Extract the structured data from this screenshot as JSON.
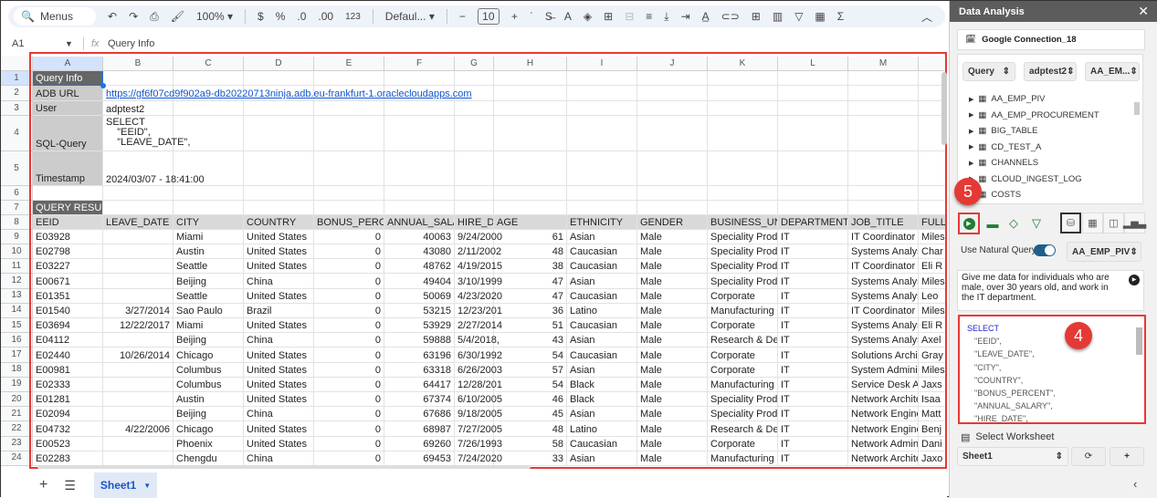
{
  "toolbar": {
    "menus_label": "Menus",
    "zoom": "100%",
    "currency": "$",
    "percent": "%",
    "dec_decrease": ".0",
    "dec_increase": ".00",
    "format_123": "123",
    "font": "Defaul...",
    "font_size": "10"
  },
  "formula_bar": {
    "cell_ref": "A1",
    "fx": "fx",
    "content": "Query Info"
  },
  "columns": [
    "A",
    "B",
    "C",
    "D",
    "E",
    "F",
    "G",
    "H",
    "I",
    "J",
    "K",
    "L",
    "M",
    ""
  ],
  "info": {
    "title": "Query Info",
    "url_label": "ADB URL",
    "url": "https://gf6f07cd9f902a9-db20220713ninja.adb.eu-frankfurt-1.oraclecloudapps.com",
    "user_label": "User",
    "user": "adptest2",
    "sql_label": "SQL-Query",
    "sql": "SELECT\n    \"EEID\",\n    \"LEAVE_DATE\",",
    "ts_label": "Timestamp",
    "ts": "2024/03/07 - 18:41:00",
    "results_label": "QUERY RESULT"
  },
  "headers": [
    "EEID",
    "LEAVE_DATE",
    "CITY",
    "COUNTRY",
    "BONUS_PERCE",
    "ANNUAL_SALAI",
    "HIRE_DA",
    "AGE",
    "ETHNICITY",
    "GENDER",
    "BUSINESS_UNI",
    "DEPARTMENT",
    "JOB_TITLE",
    "FULL"
  ],
  "rows": [
    [
      "E03928",
      "",
      "Miami",
      "United States",
      "0",
      "40063",
      "9/24/2000",
      "61",
      "Asian",
      "Male",
      "Speciality Produ",
      "IT",
      "IT Coordinator",
      "Miles"
    ],
    [
      "E02798",
      "",
      "Austin",
      "United States",
      "0",
      "43080",
      "2/11/2002",
      "48",
      "Caucasian",
      "Male",
      "Speciality Produ",
      "IT",
      "Systems Analyst",
      "Char"
    ],
    [
      "E03227",
      "",
      "Seattle",
      "United States",
      "0",
      "48762",
      "4/19/2015",
      "38",
      "Caucasian",
      "Male",
      "Speciality Produ",
      "IT",
      "IT Coordinator",
      "Eli R"
    ],
    [
      "E00671",
      "",
      "Beijing",
      "China",
      "0",
      "49404",
      "3/10/1999",
      "47",
      "Asian",
      "Male",
      "Speciality Produ",
      "IT",
      "Systems Analyst",
      "Miles"
    ],
    [
      "E01351",
      "",
      "Seattle",
      "United States",
      "0",
      "50069",
      "4/23/2020",
      "47",
      "Caucasian",
      "Male",
      "Corporate",
      "IT",
      "Systems Analyst",
      "Leo"
    ],
    [
      "E01540",
      "3/27/2014",
      "Sao Paulo",
      "Brazil",
      "0",
      "53215",
      "12/23/201",
      "36",
      "Latino",
      "Male",
      "Manufacturing",
      "IT",
      "IT Coordinator",
      "Miles"
    ],
    [
      "E03694",
      "12/22/2017",
      "Miami",
      "United States",
      "0",
      "53929",
      "2/27/2014",
      "51",
      "Caucasian",
      "Male",
      "Corporate",
      "IT",
      "Systems Analyst",
      "Eli R"
    ],
    [
      "E04112",
      "",
      "Beijing",
      "China",
      "0",
      "59888",
      "5/4/2018,",
      "43",
      "Asian",
      "Male",
      "Research & Dev",
      "IT",
      "Systems Analyst",
      "Axel"
    ],
    [
      "E02440",
      "10/26/2014",
      "Chicago",
      "United States",
      "0",
      "63196",
      "6/30/1992",
      "54",
      "Caucasian",
      "Male",
      "Corporate",
      "IT",
      "Solutions Archite",
      "Gray"
    ],
    [
      "E00981",
      "",
      "Columbus",
      "United States",
      "0",
      "63318",
      "6/26/2003",
      "57",
      "Asian",
      "Male",
      "Corporate",
      "IT",
      "System Administ",
      "Miles"
    ],
    [
      "E02333",
      "",
      "Columbus",
      "United States",
      "0",
      "64417",
      "12/28/201",
      "54",
      "Black",
      "Male",
      "Manufacturing",
      "IT",
      "Service Desk An",
      "Jaxs"
    ],
    [
      "E01281",
      "",
      "Austin",
      "United States",
      "0",
      "67374",
      "6/10/2005",
      "46",
      "Black",
      "Male",
      "Speciality Produ",
      "IT",
      "Network Architec",
      "Isaa"
    ],
    [
      "E02094",
      "",
      "Beijing",
      "China",
      "0",
      "67686",
      "9/18/2005",
      "45",
      "Asian",
      "Male",
      "Speciality Produ",
      "IT",
      "Network Enginee",
      "Matt"
    ],
    [
      "E04732",
      "4/22/2006",
      "Chicago",
      "United States",
      "0",
      "68987",
      "7/27/2005",
      "48",
      "Latino",
      "Male",
      "Research & Dev",
      "IT",
      "Network Enginee",
      "Benj"
    ],
    [
      "E00523",
      "",
      "Phoenix",
      "United States",
      "0",
      "69260",
      "7/26/1993",
      "58",
      "Caucasian",
      "Male",
      "Corporate",
      "IT",
      "Network Adminis",
      "Dani"
    ],
    [
      "E02283",
      "",
      "Chengdu",
      "China",
      "0",
      "69453",
      "7/24/2020",
      "33",
      "Asian",
      "Male",
      "Manufacturing",
      "IT",
      "Network Architec",
      "Jaxo"
    ]
  ],
  "sheet_tabs": {
    "active": "Sheet1"
  },
  "panel": {
    "title": "Data Analysis",
    "connection": "Google Connection_18",
    "mode": "Query",
    "schema": "adptest2",
    "table": "AA_EM...",
    "tables": [
      "AA_EMP_PIV",
      "AA_EMP_PROCUREMENT",
      "BIG_TABLE",
      "CD_TEST_A",
      "CHANNELS",
      "CLOUD_INGEST_LOG",
      "COSTS"
    ],
    "natural_query_label": "Use Natural Query",
    "natural_query_on": true,
    "nq_table": "AA_EMP_PIV",
    "prompt": "Give me data for individuals who are male, over 30 years old, and work in the IT department.",
    "sql_lines": [
      "SELECT",
      "\"EEID\",",
      "\"LEAVE_DATE\",",
      "\"CITY\",",
      "\"COUNTRY\",",
      "\"BONUS_PERCENT\",",
      "\"ANNUAL_SALARY\",",
      "\"HIRE_DATE\","
    ],
    "select_ws_label": "Select Worksheet",
    "worksheet": "Sheet1",
    "refresh": "⟳",
    "add": "+"
  },
  "badges": {
    "run": "5",
    "sql": "4"
  },
  "colors": {
    "highlight": "#e53935",
    "run_green": "#1e7e34",
    "toggle": "#1f5f8b"
  }
}
